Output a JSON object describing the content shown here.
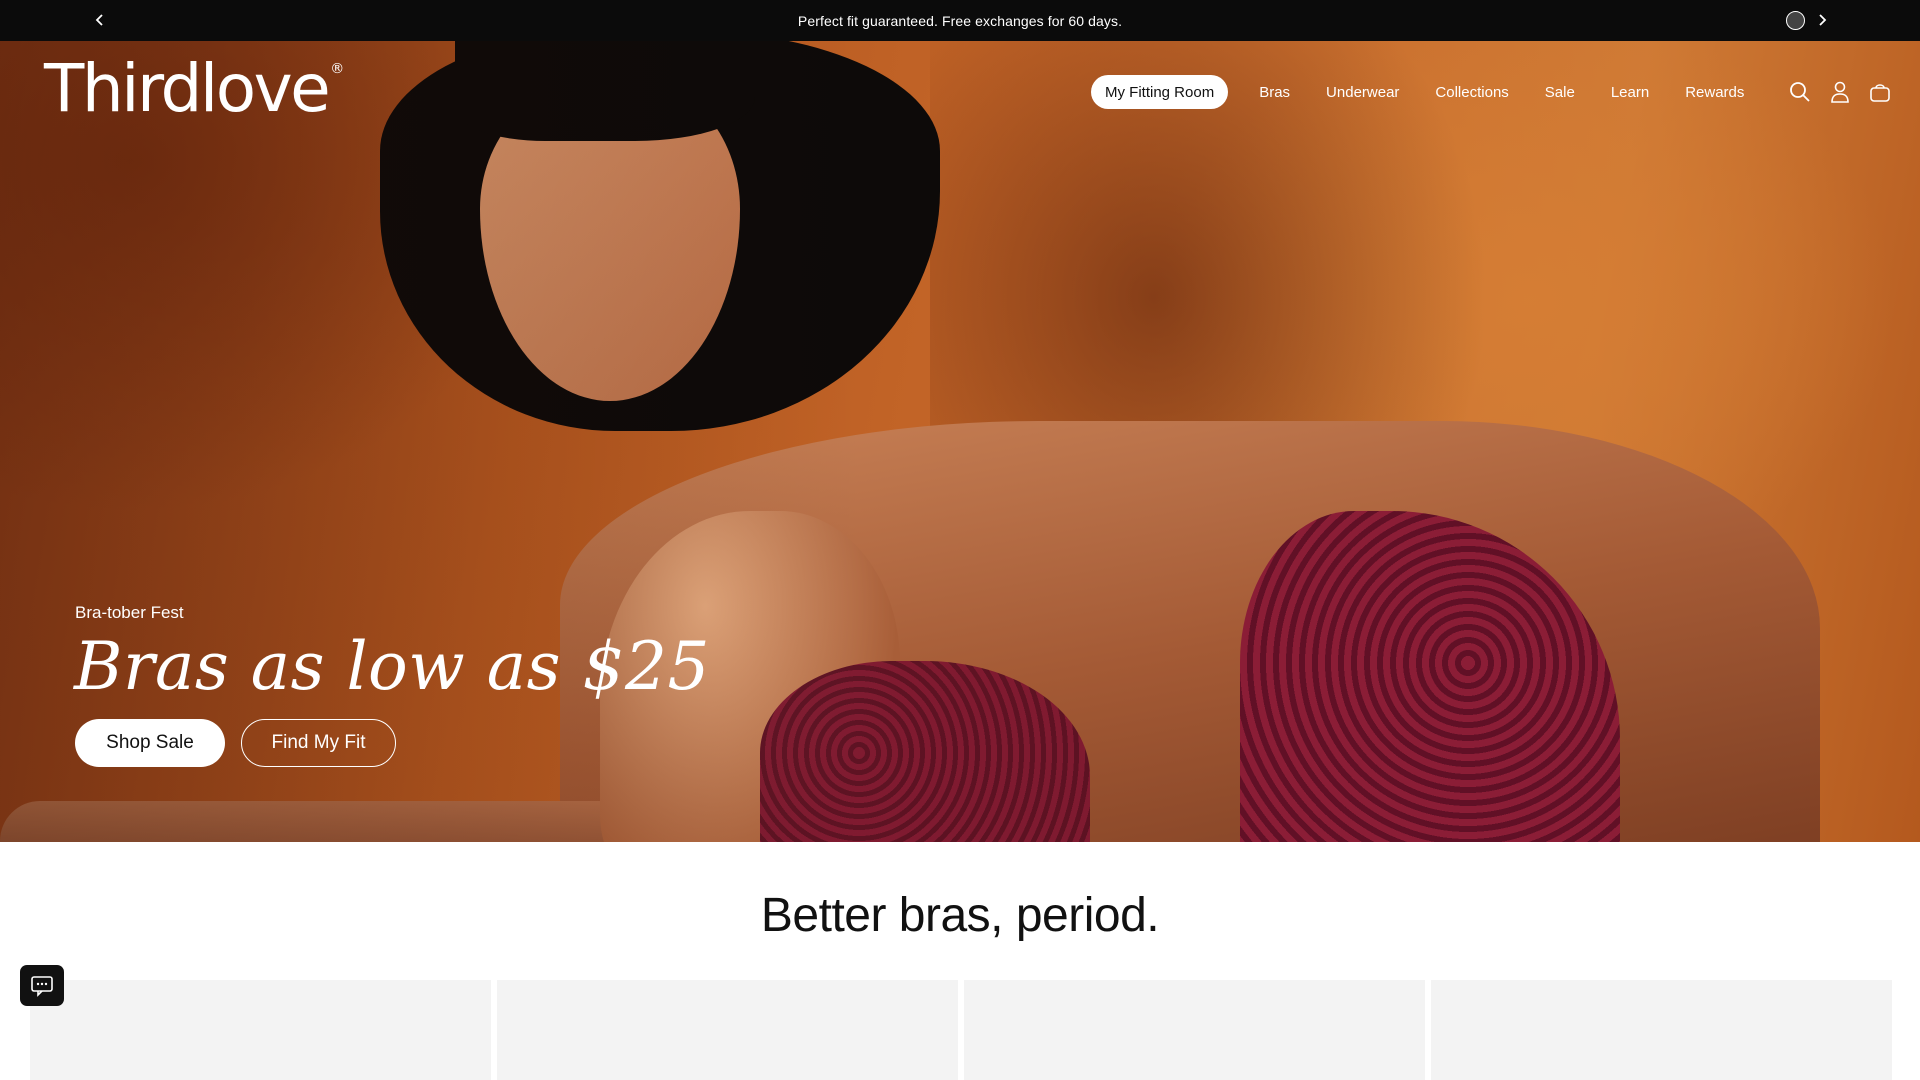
{
  "announcement": {
    "text": "Perfect fit guaranteed. Free exchanges for 60 days."
  },
  "header": {
    "logo": "Thirdlove",
    "logo_mark": "®",
    "nav": [
      {
        "label": "My Fitting Room"
      },
      {
        "label": "Bras"
      },
      {
        "label": "Underwear"
      },
      {
        "label": "Collections"
      },
      {
        "label": "Sale"
      },
      {
        "label": "Learn"
      },
      {
        "label": "Rewards"
      }
    ],
    "icons": [
      "search-icon",
      "account-icon",
      "cart-icon"
    ]
  },
  "hero": {
    "eyebrow": "Bra-tober Fest",
    "headline": "Bras as low as $25",
    "primary_cta": "Shop Sale",
    "secondary_cta": "Find My Fit"
  },
  "section": {
    "title": "Better bras, period."
  },
  "colors": {
    "announcement_bg": "#0b0b0b",
    "hero_orange": "#c7692a",
    "lace_burgundy": "#7e1730"
  }
}
